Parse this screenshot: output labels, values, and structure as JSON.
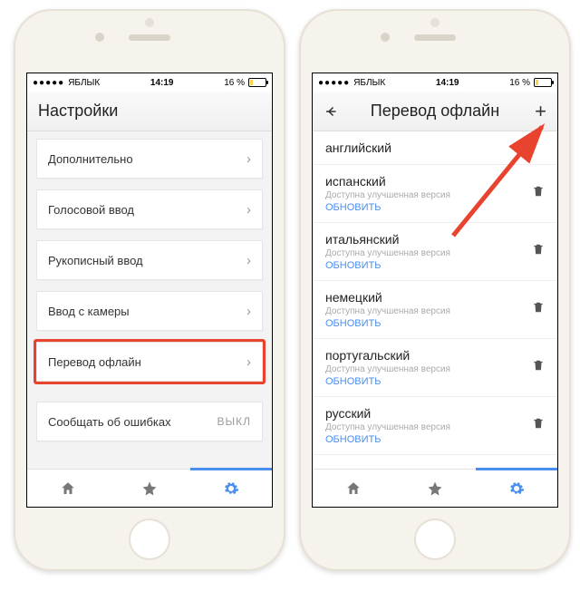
{
  "status": {
    "carrier": "ЯБЛЫК",
    "time": "14:19",
    "battery_pct": "16 %"
  },
  "left": {
    "title": "Настройки",
    "items": [
      {
        "label": "Дополнительно"
      },
      {
        "label": "Голосовой ввод"
      },
      {
        "label": "Рукописный ввод"
      },
      {
        "label": "Ввод с камеры"
      },
      {
        "label": "Перевод офлайн",
        "highlight": true
      },
      {
        "label": "Сообщать об ошибках",
        "toggle": "ВЫКЛ"
      }
    ]
  },
  "right": {
    "title": "Перевод офлайн",
    "langs": [
      {
        "name": "английский",
        "sub": "",
        "update": ""
      },
      {
        "name": "испанский",
        "sub": "Доступна улучшенная версия",
        "update": "ОБНОВИТЬ"
      },
      {
        "name": "итальянский",
        "sub": "Доступна улучшенная версия",
        "update": "ОБНОВИТЬ"
      },
      {
        "name": "немецкий",
        "sub": "Доступна улучшенная версия",
        "update": "ОБНОВИТЬ"
      },
      {
        "name": "португальский",
        "sub": "Доступна улучшенная версия",
        "update": "ОБНОВИТЬ"
      },
      {
        "name": "русский",
        "sub": "Доступна улучшенная версия",
        "update": "ОБНОВИТЬ"
      }
    ]
  }
}
